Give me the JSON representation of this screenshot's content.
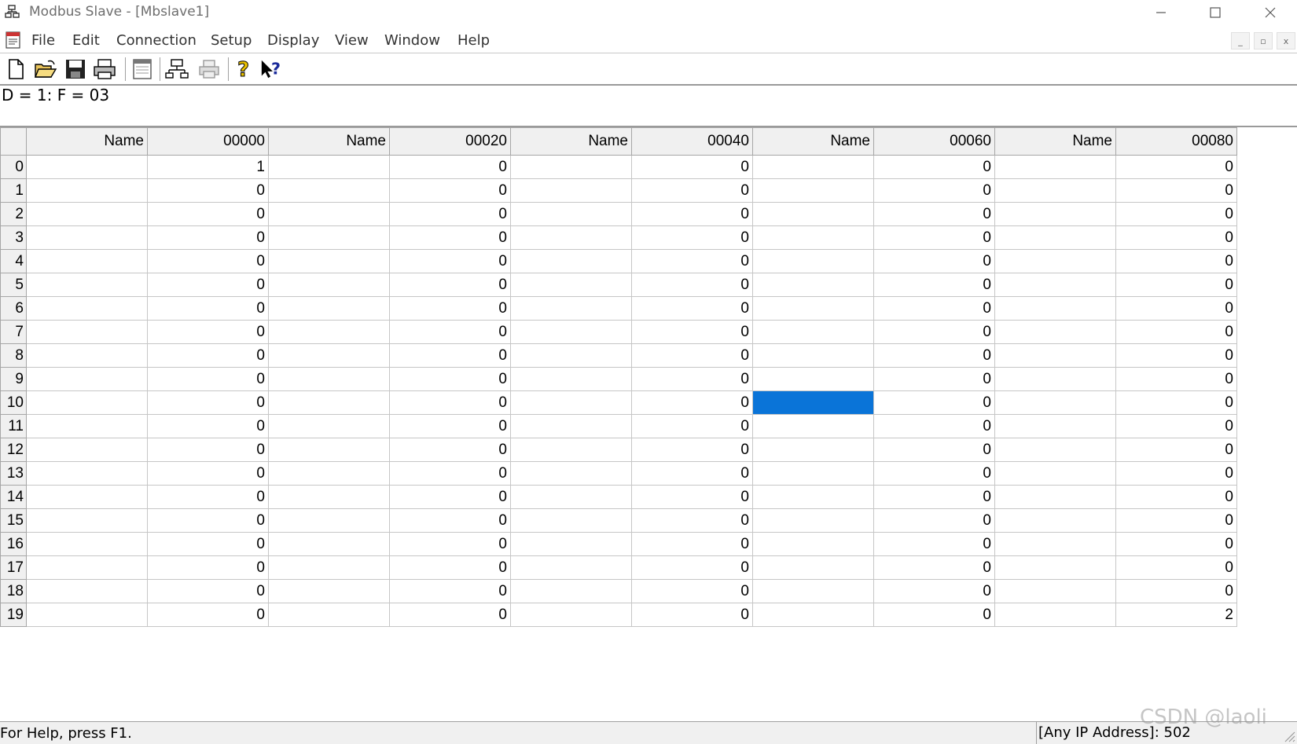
{
  "window": {
    "title": "Modbus Slave - [Mbslave1]",
    "minimize_icon": "minimize-icon",
    "maximize_icon": "maximize-icon",
    "close_icon": "close-icon"
  },
  "menu": {
    "items": [
      "File",
      "Edit",
      "Connection",
      "Setup",
      "Display",
      "View",
      "Window",
      "Help"
    ],
    "mdi": [
      "_",
      "▫",
      "x"
    ]
  },
  "toolbar": {
    "buttons": [
      "new-document-icon",
      "open-folder-icon",
      "save-disk-icon",
      "print-icon",
      "window-icon",
      "connect-icon",
      "print-setup-icon",
      "help-icon",
      "context-help-icon"
    ]
  },
  "info_line": "D = 1: F = 03",
  "grid": {
    "headers": [
      "Name",
      "00000",
      "Name",
      "00020",
      "Name",
      "00040",
      "Name",
      "00060",
      "Name",
      "00080"
    ],
    "row_labels": [
      "0",
      "1",
      "2",
      "3",
      "4",
      "5",
      "6",
      "7",
      "8",
      "9",
      "10",
      "11",
      "12",
      "13",
      "14",
      "15",
      "16",
      "17",
      "18",
      "19"
    ],
    "values": [
      [
        "1",
        "0",
        "0",
        "0",
        "0"
      ],
      [
        "0",
        "0",
        "0",
        "0",
        "0"
      ],
      [
        "0",
        "0",
        "0",
        "0",
        "0"
      ],
      [
        "0",
        "0",
        "0",
        "0",
        "0"
      ],
      [
        "0",
        "0",
        "0",
        "0",
        "0"
      ],
      [
        "0",
        "0",
        "0",
        "0",
        "0"
      ],
      [
        "0",
        "0",
        "0",
        "0",
        "0"
      ],
      [
        "0",
        "0",
        "0",
        "0",
        "0"
      ],
      [
        "0",
        "0",
        "0",
        "0",
        "0"
      ],
      [
        "0",
        "0",
        "0",
        "0",
        "0"
      ],
      [
        "0",
        "0",
        "0",
        "0",
        "0"
      ],
      [
        "0",
        "0",
        "0",
        "0",
        "0"
      ],
      [
        "0",
        "0",
        "0",
        "0",
        "0"
      ],
      [
        "0",
        "0",
        "0",
        "0",
        "0"
      ],
      [
        "0",
        "0",
        "0",
        "0",
        "0"
      ],
      [
        "0",
        "0",
        "0",
        "0",
        "0"
      ],
      [
        "0",
        "0",
        "0",
        "0",
        "0"
      ],
      [
        "0",
        "0",
        "0",
        "0",
        "0"
      ],
      [
        "0",
        "0",
        "0",
        "0",
        "0"
      ],
      [
        "0",
        "0",
        "0",
        "0",
        "2"
      ]
    ],
    "selected_cell": {
      "row": 10,
      "column": 6
    },
    "selection_color": "#0a74d8"
  },
  "status": {
    "left": "For Help, press F1.",
    "right": "[Any IP Address]: 502"
  },
  "watermark": "CSDN @laoli"
}
